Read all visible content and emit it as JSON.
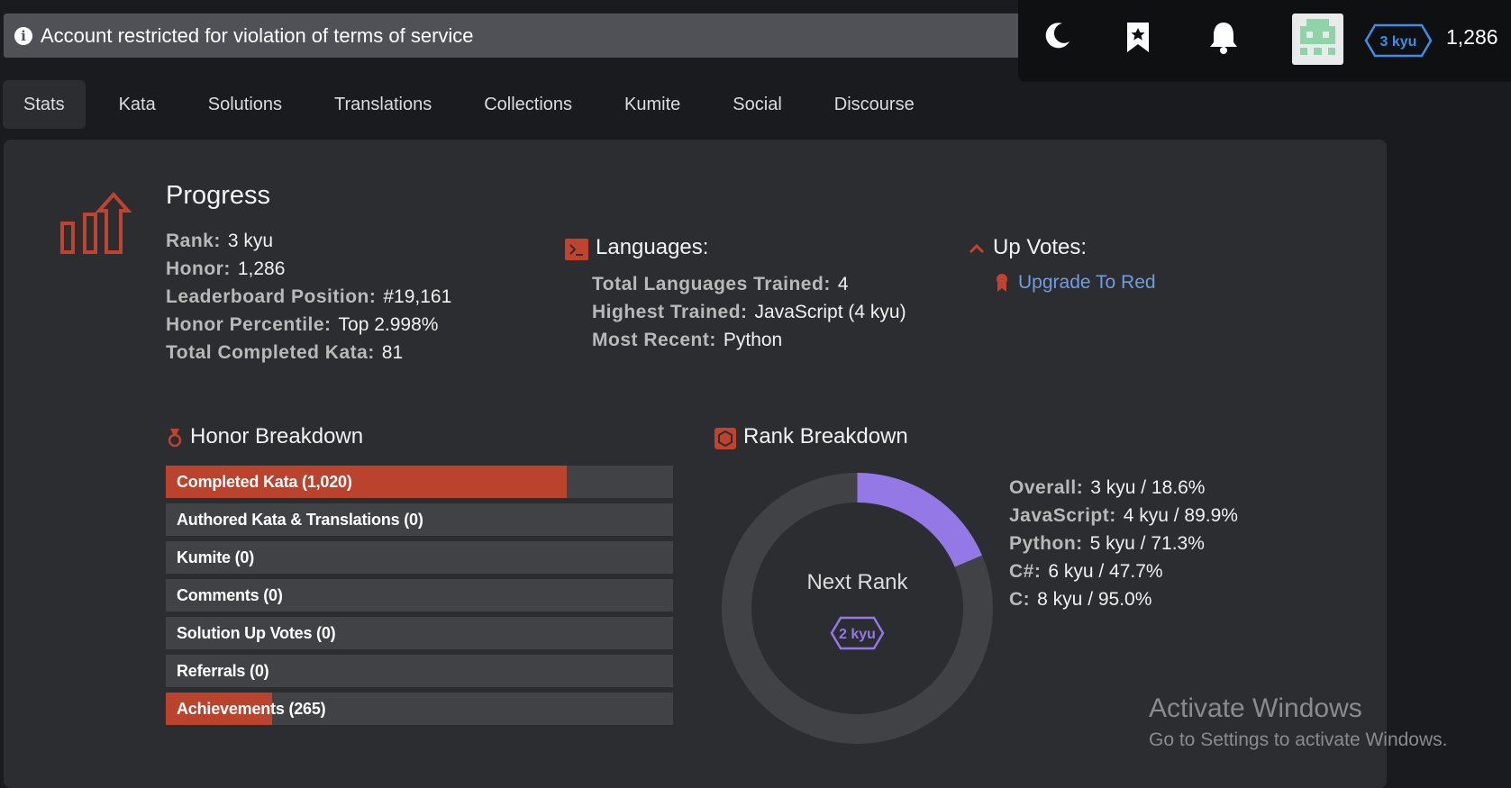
{
  "banner": {
    "text": "Account restricted for violation of terms of service"
  },
  "topbar": {
    "rank": "3 kyu",
    "honor": "1,286"
  },
  "tabs": [
    {
      "label": "Stats",
      "active": true
    },
    {
      "label": "Kata"
    },
    {
      "label": "Solutions"
    },
    {
      "label": "Translations"
    },
    {
      "label": "Collections"
    },
    {
      "label": "Kumite"
    },
    {
      "label": "Social"
    },
    {
      "label": "Discourse"
    }
  ],
  "progress": {
    "title": "Progress",
    "rows": [
      {
        "label": "Rank:",
        "value": "3 kyu"
      },
      {
        "label": "Honor:",
        "value": "1,286"
      },
      {
        "label": "Leaderboard Position:",
        "value": "#19,161"
      },
      {
        "label": "Honor Percentile:",
        "value": "Top 2.998%"
      },
      {
        "label": "Total Completed Kata:",
        "value": "81"
      }
    ]
  },
  "languages": {
    "title": "Languages:",
    "rows": [
      {
        "label": "Total Languages Trained:",
        "value": "4"
      },
      {
        "label": "Highest Trained:",
        "value": "JavaScript (4 kyu)"
      },
      {
        "label": "Most Recent:",
        "value": "Python"
      }
    ]
  },
  "upvotes": {
    "title": "Up Votes:",
    "link": "Upgrade To Red"
  },
  "honor_breakdown": {
    "title": "Honor Breakdown",
    "bars": [
      {
        "label": "Completed Kata (1,020)",
        "fill": 0.79
      },
      {
        "label": "Authored Kata & Translations (0)",
        "fill": 0
      },
      {
        "label": "Kumite (0)",
        "fill": 0
      },
      {
        "label": "Comments (0)",
        "fill": 0
      },
      {
        "label": "Solution Up Votes (0)",
        "fill": 0
      },
      {
        "label": "Referrals (0)",
        "fill": 0
      },
      {
        "label": "Achievements (265)",
        "fill": 0.21
      }
    ]
  },
  "rank_breakdown": {
    "title": "Rank Breakdown",
    "next_rank_label": "Next Rank",
    "next_rank": "2 kyu",
    "progress": 0.186,
    "rows": [
      {
        "label": "Overall:",
        "value": "3 kyu / 18.6%"
      },
      {
        "label": "JavaScript:",
        "value": "4 kyu / 89.9%"
      },
      {
        "label": "Python:",
        "value": "5 kyu / 71.3%"
      },
      {
        "label": "C#:",
        "value": "6 kyu / 47.7%"
      },
      {
        "label": "C:",
        "value": "8 kyu / 95.0%"
      }
    ]
  },
  "watermark": {
    "title": "Activate Windows",
    "subtitle": "Go to Settings to activate Windows."
  },
  "colors": {
    "accent": "#bb432e",
    "purple": "#9478e6",
    "blue_rank": "#3c8ee8",
    "link": "#6e9de0"
  }
}
